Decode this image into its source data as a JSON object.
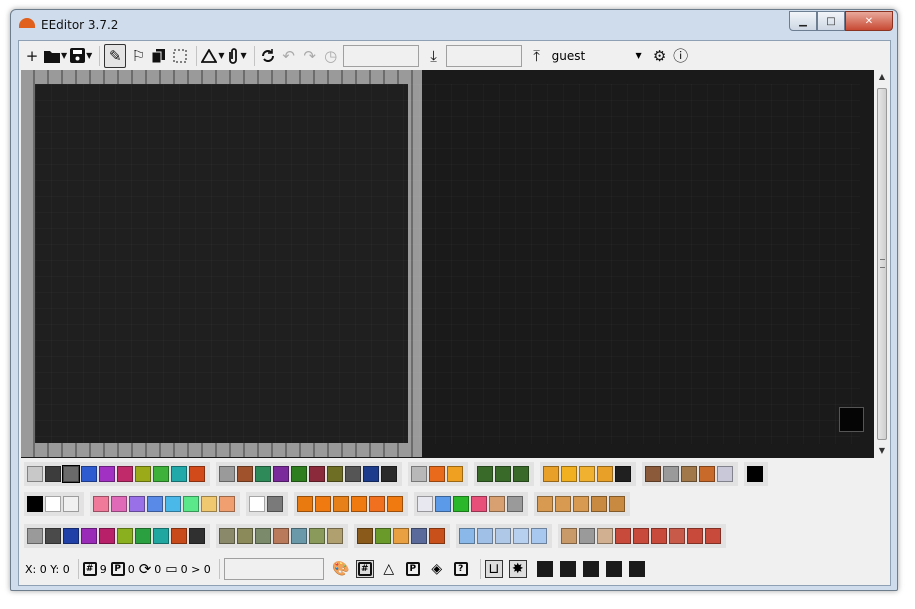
{
  "window": {
    "title": "EEditor 3.7.2",
    "buttons": {
      "min": "▁",
      "max": "□",
      "close": "✕"
    }
  },
  "toolbar": {
    "new_icon": "+",
    "open_icon": "folder-icon",
    "save_icon": "save-icon",
    "pen_icon": "✎",
    "fill_icon": "⚐",
    "undo_icon": "↶",
    "redo_icon": "↷",
    "history_icon": "◷",
    "world_id_value": "",
    "world_name_value": "",
    "account_value": "guest",
    "download_icon": "⤓",
    "upload_icon": "⤒",
    "settings_icon": "⚙",
    "info_icon": "ⓘ"
  },
  "palette": {
    "row1": [
      [
        "#c8c8c8",
        "#3c3c3c",
        "#6a6a6a",
        "#2f5bd0",
        "#a131c2",
        "#c02a6a",
        "#9aaa18",
        "#3db13a",
        "#21a8a8",
        "#d24a1a"
      ],
      [
        "#9a9a9a",
        "#a0522d",
        "#2f8a5a",
        "#7a2a9a",
        "#2e7d1e",
        "#8a2a3a",
        "#6e6e24",
        "#555555",
        "#1e3c8c",
        "#2a2a2a"
      ],
      [
        "#b8b8b8",
        "#e86a1a",
        "#f0a020"
      ],
      [
        "#3a6a2a",
        "#3a6a2a",
        "#3a6a2a"
      ],
      [
        "#e8a028",
        "#f0b020",
        "#f0b030",
        "#e8a028",
        "#202020"
      ],
      [
        "#8a5a3a",
        "#9a9a9a",
        "#a0784a",
        "#c86a2a",
        "#c8c8d8"
      ],
      [
        "#000000"
      ]
    ],
    "row2": [
      [
        "#000000",
        "#ffffff",
        "#f0f0f0"
      ],
      [
        "#f07a9a",
        "#e06ab8",
        "#9a70e8",
        "#5a8ae8",
        "#4ab8e8",
        "#5ae88a",
        "#f0c870",
        "#f0a070"
      ],
      [
        "#ffffff",
        "#7a7a7a"
      ],
      [
        "#e87a10",
        "#f07a10",
        "#e8801a",
        "#f07a10",
        "#f07020",
        "#f07a10"
      ],
      [
        "#e8e8f0",
        "#5a9ae8",
        "#2ab82a",
        "#e8507a",
        "#d8a070",
        "#9a9a9a"
      ],
      [
        "#d89a50",
        "#d89a50",
        "#d89a50",
        "#c88a40",
        "#c88a40"
      ]
    ],
    "row3": [
      [
        "#9a9a9a",
        "#4a4a4a",
        "#2040a8",
        "#9a2ab8",
        "#b8206a",
        "#8ab020",
        "#2aa040",
        "#20a8a0",
        "#c84a1a",
        "#303030"
      ],
      [
        "#8a8a6a",
        "#8a8a5a",
        "#7a8a6a",
        "#b87a5a",
        "#6a9aaa",
        "#8a9a5a",
        "#b0a070"
      ],
      [
        "#8a5a1a",
        "#6a9a2a",
        "#e8a040",
        "#5a6a9a",
        "#c8501a"
      ],
      [
        "#8ab8e8",
        "#a0c0e8",
        "#b0c8e8",
        "#b8d0f0",
        "#a8c8f0"
      ],
      [
        "#c89a6a",
        "#9a9a9a",
        "#d0b090",
        "#c84a3a",
        "#c84a3a",
        "#c84a3a",
        "#c85a4a",
        "#c84a3a",
        "#c84a3a"
      ]
    ]
  },
  "status": {
    "coords": "X: 0 Y: 0",
    "blocks_count": "9",
    "portals_count": "0",
    "rotations_count": "0",
    "labels_count": "0 > 0",
    "search_value": "",
    "palette_icon": "🎨",
    "layer_colors": [
      "#1a1a1a",
      "#1a1a1a",
      "#1a1a1a",
      "#1a1a1a",
      "#1a1a1a"
    ]
  }
}
